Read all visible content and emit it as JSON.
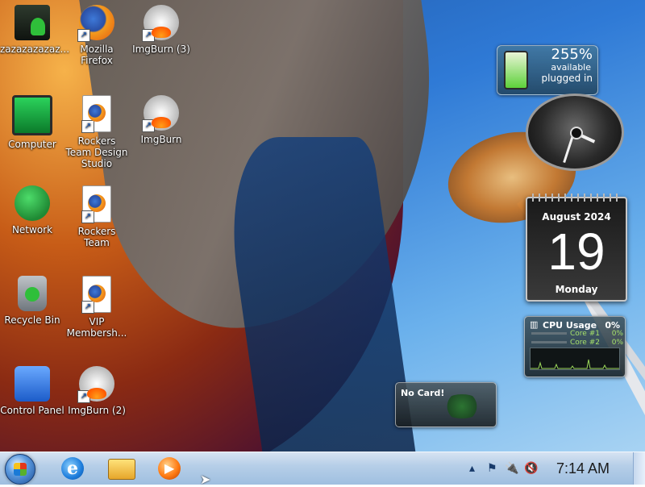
{
  "desktop": {
    "icons": [
      {
        "name": "zazazazazaz-icon",
        "label": "zazazazazaz...",
        "art": "user",
        "shortcut": false
      },
      {
        "name": "mozilla-firefox-icon",
        "label": "Mozilla Firefox",
        "art": "firefox",
        "shortcut": true
      },
      {
        "name": "imgburn-3-icon",
        "label": "ImgBurn (3)",
        "art": "disc",
        "shortcut": true
      },
      {
        "name": "computer-icon",
        "label": "Computer",
        "art": "computer",
        "shortcut": false
      },
      {
        "name": "rockers-team-design-studio-icon",
        "label": "Rockers Team Design Studio",
        "art": "file",
        "shortcut": true
      },
      {
        "name": "imgburn-icon",
        "label": "ImgBurn",
        "art": "disc",
        "shortcut": true
      },
      {
        "name": "network-icon",
        "label": "Network",
        "art": "network",
        "shortcut": false
      },
      {
        "name": "rockers-team-icon",
        "label": "Rockers Team",
        "art": "file",
        "shortcut": true
      },
      {
        "name": "recycle-bin-icon",
        "label": "Recycle Bin",
        "art": "recycle",
        "shortcut": false
      },
      {
        "name": "vip-membership-icon",
        "label": "VIP Membersh...",
        "art": "file",
        "shortcut": true
      },
      {
        "name": "control-panel-icon",
        "label": "Control Panel",
        "art": "control",
        "shortcut": false
      },
      {
        "name": "imgburn-2-icon",
        "label": "ImgBurn (2)",
        "art": "disc",
        "shortcut": true
      }
    ]
  },
  "gadgets": {
    "battery": {
      "percent": "255%",
      "status1": "available",
      "status2": "plugged in"
    },
    "calendar": {
      "month": "August 2024",
      "day": "19",
      "weekday": "Monday"
    },
    "cpu": {
      "title": "CPU Usage",
      "total": "0%",
      "cores": [
        {
          "label": "Core #1",
          "value": "0%"
        },
        {
          "label": "Core #2",
          "value": "0%"
        }
      ]
    },
    "gpu_card": {
      "label": "No Card!"
    }
  },
  "taskbar": {
    "pinned": [
      "internet-explorer-icon",
      "windows-explorer-icon",
      "media-player-icon"
    ],
    "tray": {
      "time": "7:14 AM"
    }
  },
  "colors": {
    "taskbar_top": "#d6e3f2",
    "taskbar_bottom": "#9fbfe0",
    "sky": "#2f7ad6"
  }
}
